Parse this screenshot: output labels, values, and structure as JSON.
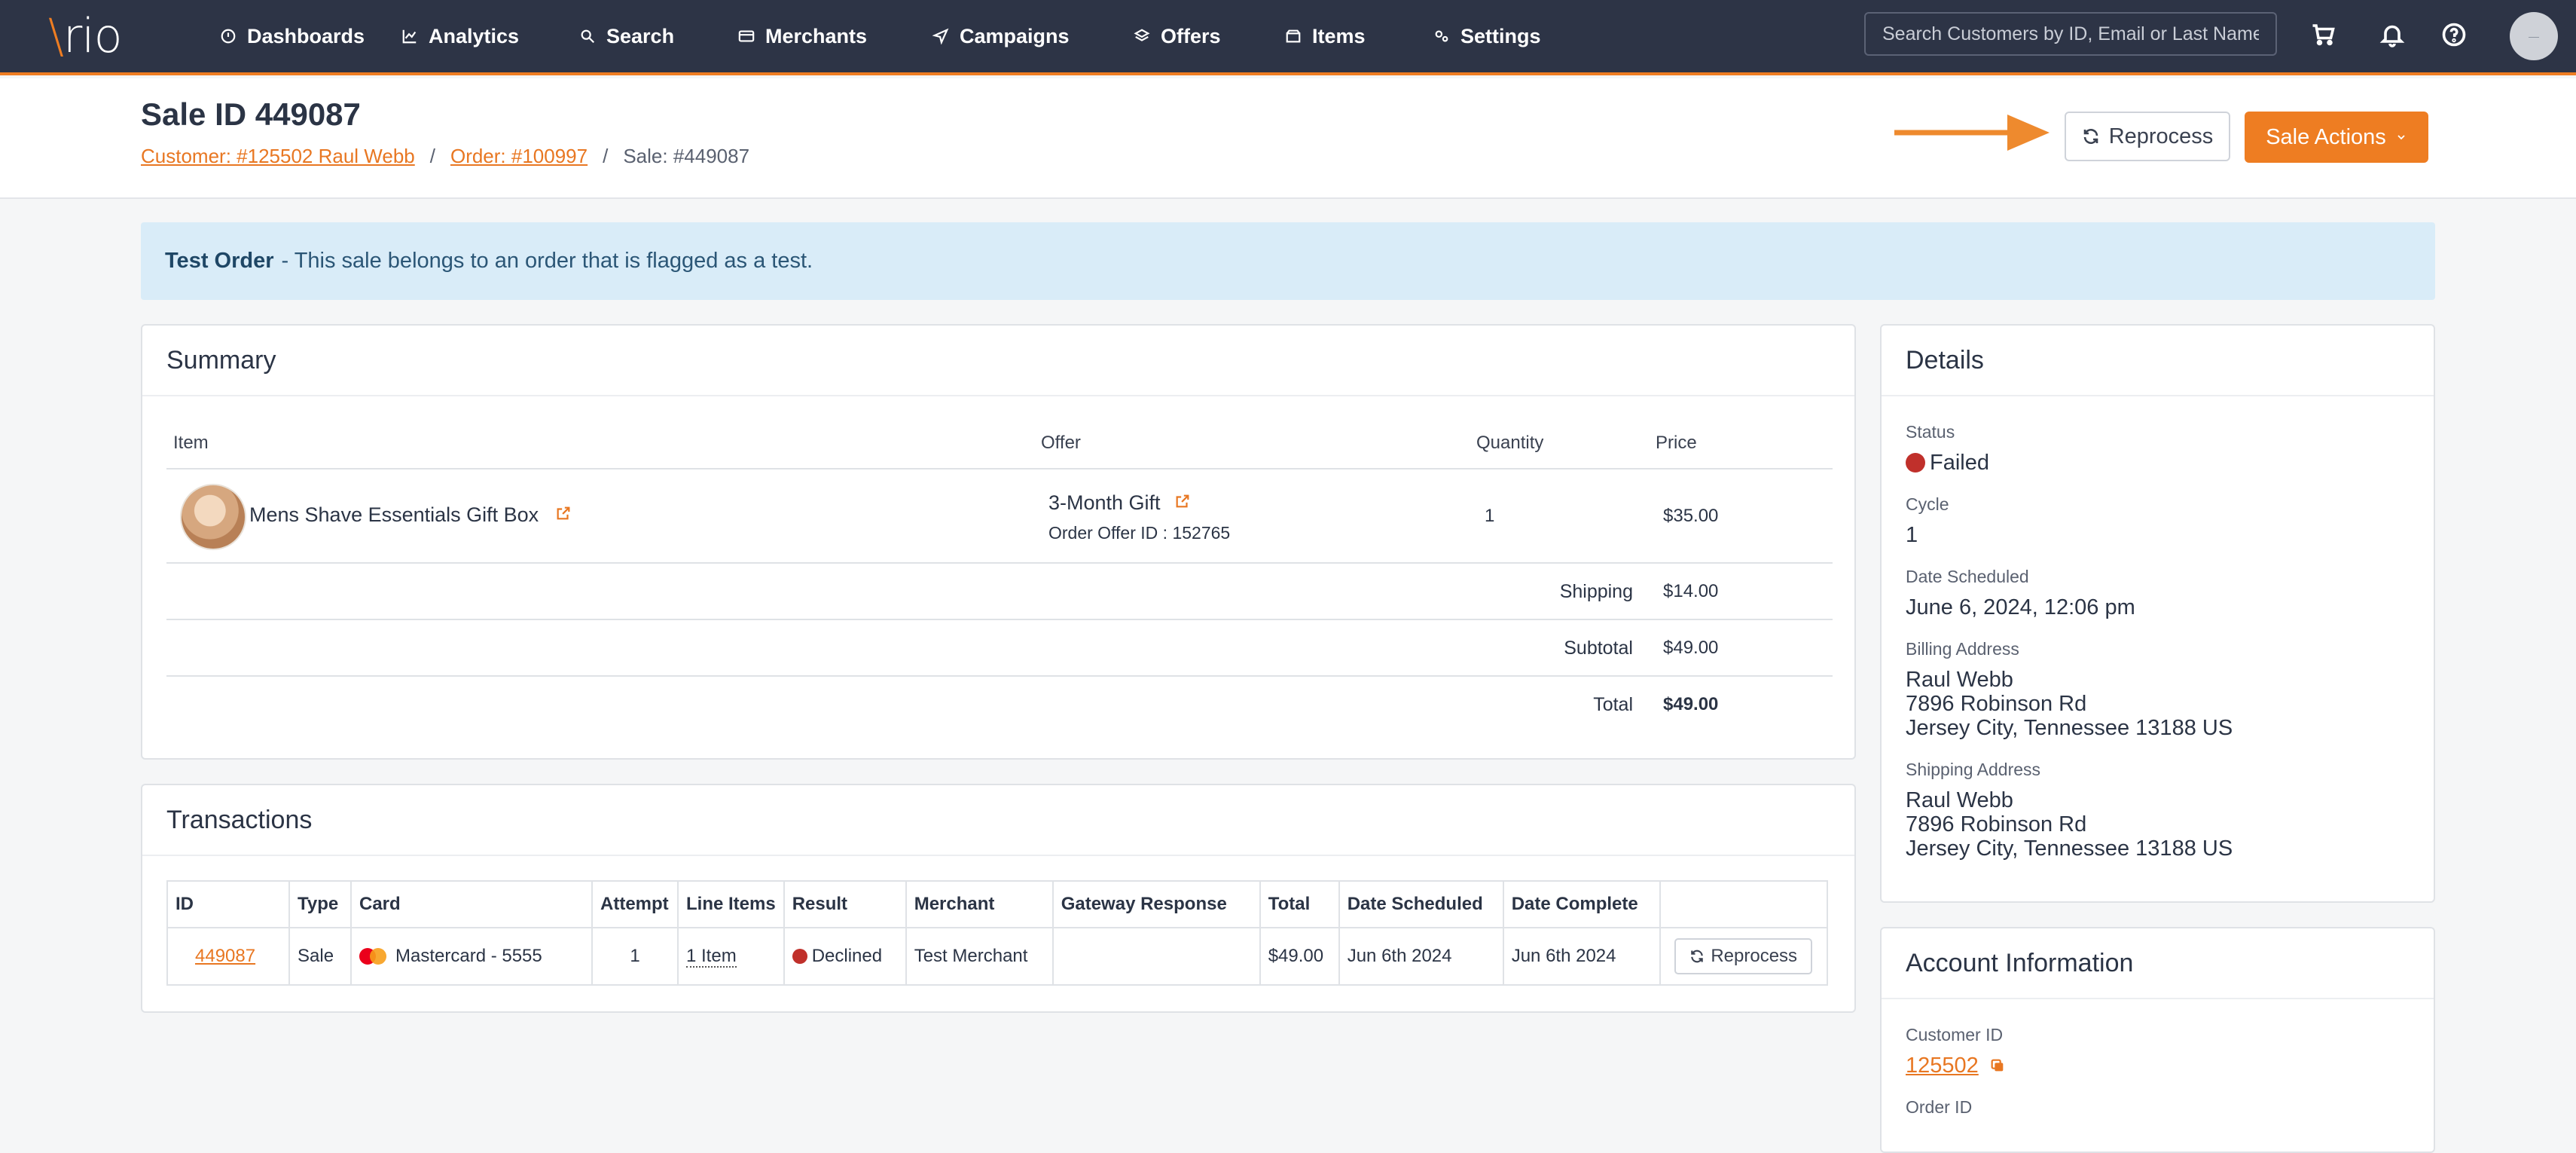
{
  "nav": {
    "logo": "vrio",
    "items": [
      "Dashboards",
      "Analytics",
      "Search",
      "Merchants",
      "Campaigns",
      "Offers",
      "Items",
      "Settings"
    ],
    "search_placeholder": "Search Customers by ID, Email or Last Name",
    "accent": "#ee7d22"
  },
  "header": {
    "title": "Sale ID 449087",
    "breadcrumb": {
      "customer": "Customer: #125502 Raul Webb",
      "order": "Order: #100997",
      "sale": "Sale: #449087",
      "separator": "/"
    },
    "reprocess_label": "Reprocess",
    "sale_actions_label": "Sale Actions"
  },
  "alert": {
    "title": "Test Order",
    "message": "- This sale belongs to an order that is flagged as a test."
  },
  "summary": {
    "title": "Summary",
    "columns": [
      "Item",
      "Offer",
      "Quantity",
      "Price"
    ],
    "item": {
      "name": "Mens Shave Essentials Gift Box",
      "offer": "3-Month Gift",
      "order_offer_id": "Order Offer ID : 152765",
      "quantity": "1",
      "price": "$35.00"
    },
    "shipping_label": "Shipping",
    "shipping": "$14.00",
    "subtotal_label": "Subtotal",
    "subtotal": "$49.00",
    "total_label": "Total",
    "total": "$49.00"
  },
  "transactions": {
    "title": "Transactions",
    "columns": [
      "ID",
      "Type",
      "Card",
      "Attempt",
      "Line Items",
      "Result",
      "Merchant",
      "Gateway Response",
      "Total",
      "Date Scheduled",
      "Date Complete"
    ],
    "row": {
      "id": "449087",
      "type": "Sale",
      "card": "Mastercard - 5555",
      "attempt": "1",
      "line_items": "1 Item",
      "result": "Declined",
      "merchant": "Test Merchant",
      "gateway_response": "",
      "total": "$49.00",
      "date_scheduled": "Jun 6th 2024",
      "date_complete": "Jun 6th 2024",
      "action": "Reprocess"
    }
  },
  "details": {
    "title": "Details",
    "status_label": "Status",
    "status": "Failed",
    "cycle_label": "Cycle",
    "cycle": "1",
    "date_label": "Date Scheduled",
    "date": "June 6, 2024, 12:06 pm",
    "billing_label": "Billing Address",
    "billing": [
      "Raul Webb",
      "7896 Robinson Rd",
      "Jersey City, Tennessee 13188 US"
    ],
    "shipping_label": "Shipping Address",
    "shipping": [
      "Raul Webb",
      "7896 Robinson Rd",
      "Jersey City, Tennessee 13188 US"
    ]
  },
  "account": {
    "title": "Account Information",
    "customer_id_label": "Customer ID",
    "customer_id": "125502",
    "order_id_label": "Order ID"
  }
}
